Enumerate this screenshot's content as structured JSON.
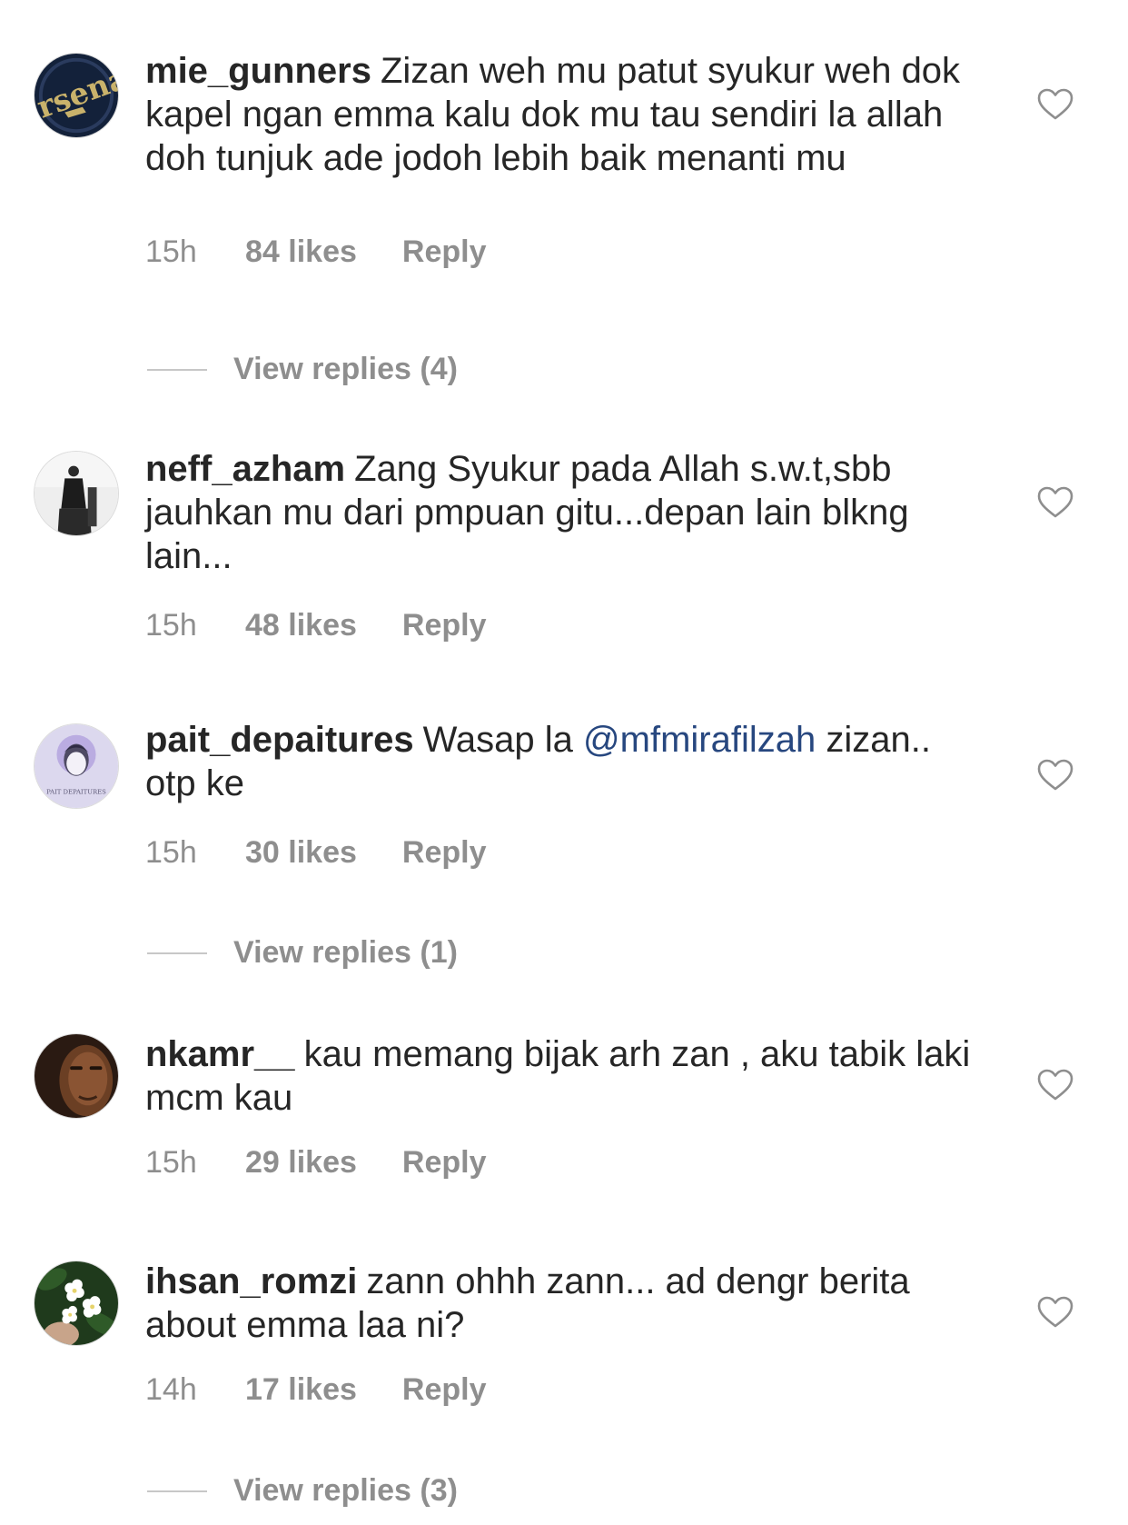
{
  "comments": [
    {
      "username": "mie_gunners",
      "text": "Zizan weh mu patut syukur weh dok kapel ngan emma kalu dok mu tau sendiri la allah doh tunjuk ade jodoh lebih baik menanti mu",
      "time": "15h",
      "likes": "84 likes",
      "reply": "Reply",
      "view_replies": "View replies (4)",
      "avatar_icon": "arsenal-avatar"
    },
    {
      "username": "neff_azham",
      "text": "Zang Syukur pada Allah s.w.t,sbb jauhkan mu dari pmpuan gitu...depan lain blkng lain...",
      "time": "15h",
      "likes": "48 likes",
      "reply": "Reply",
      "avatar_icon": "person-avatar"
    },
    {
      "username": "pait_depaitures",
      "text_before": "Wasap la ",
      "mention": "@mfmirafilzah",
      "text_after": " zizan.. otp ke",
      "avatar_caption": "PAIT DEPAITURES",
      "time": "15h",
      "likes": "30 likes",
      "reply": "Reply",
      "view_replies": "View replies (1)",
      "avatar_icon": "portrait-avatar"
    },
    {
      "username": "nkamr__",
      "text": "kau memang bijak arh zan , aku tabik laki mcm kau",
      "time": "15h",
      "likes": "29 likes",
      "reply": "Reply",
      "avatar_icon": "face-avatar"
    },
    {
      "username": "ihsan_romzi",
      "text": "zann ohhh zann... ad dengr berita about emma laa ni?",
      "time": "14h",
      "likes": "17 likes",
      "reply": "Reply",
      "view_replies": "View replies (3)",
      "avatar_icon": "flower-avatar"
    }
  ],
  "colors": {
    "text": "#262626",
    "secondary": "#8e8e8e",
    "mention": "#27477f",
    "divider": "#c7c7c7"
  },
  "icons": {
    "like": "heart-outline-icon"
  }
}
